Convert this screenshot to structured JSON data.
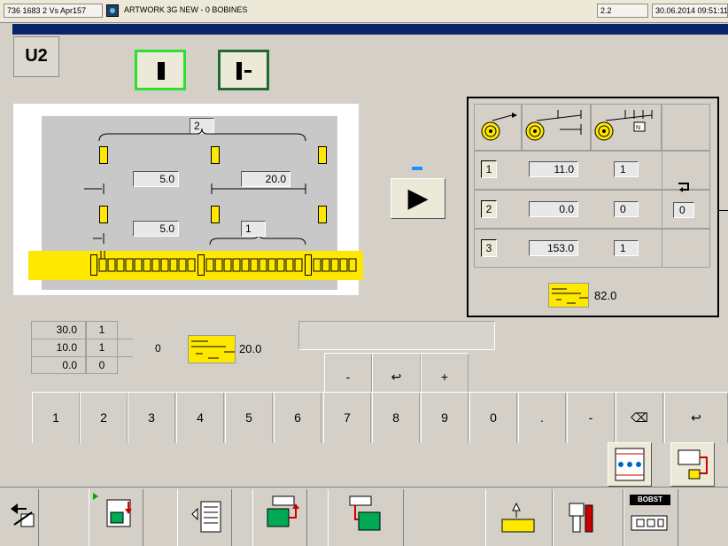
{
  "top_bar": {
    "version": "736 1683 2 Vs Apr157",
    "job": "ARTWORK 3G NEW - 0 BOBINES",
    "code": "2.2",
    "datetime": "30.06.2014 09:51:11"
  },
  "unit_label": "U2",
  "diagram": {
    "count_top": "2",
    "value_a": "5.0",
    "value_b": "20.0",
    "value_c": "5.0",
    "count_bottom": "1"
  },
  "play_label": "▶",
  "table": {
    "rows": [
      {
        "index": "1",
        "distance": "11.0",
        "count": "1"
      },
      {
        "index": "2",
        "distance": "0.0",
        "count": "0"
      },
      {
        "index": "3",
        "distance": "153.0",
        "count": "1"
      }
    ],
    "repeat_value": "0",
    "total_value": "82.0"
  },
  "summary": {
    "rows": [
      {
        "a": "30.0",
        "b": "1"
      },
      {
        "a": "10.0",
        "b": "1"
      },
      {
        "a": "0.0",
        "b": "0"
      }
    ],
    "mid_value": "0",
    "length_value": "20.0"
  },
  "edit_keys": [
    "-",
    "↩",
    "+"
  ],
  "keypad": [
    "1",
    "2",
    "3",
    "4",
    "5",
    "6",
    "7",
    "8",
    "9",
    "0",
    ".",
    "-",
    "⌫",
    "↩"
  ],
  "colors": {
    "accent_yellow": "#ffe800",
    "title_blue": "#0a246a",
    "mode_green": "#2ee02e",
    "frame_dark": "#1f6b33"
  }
}
